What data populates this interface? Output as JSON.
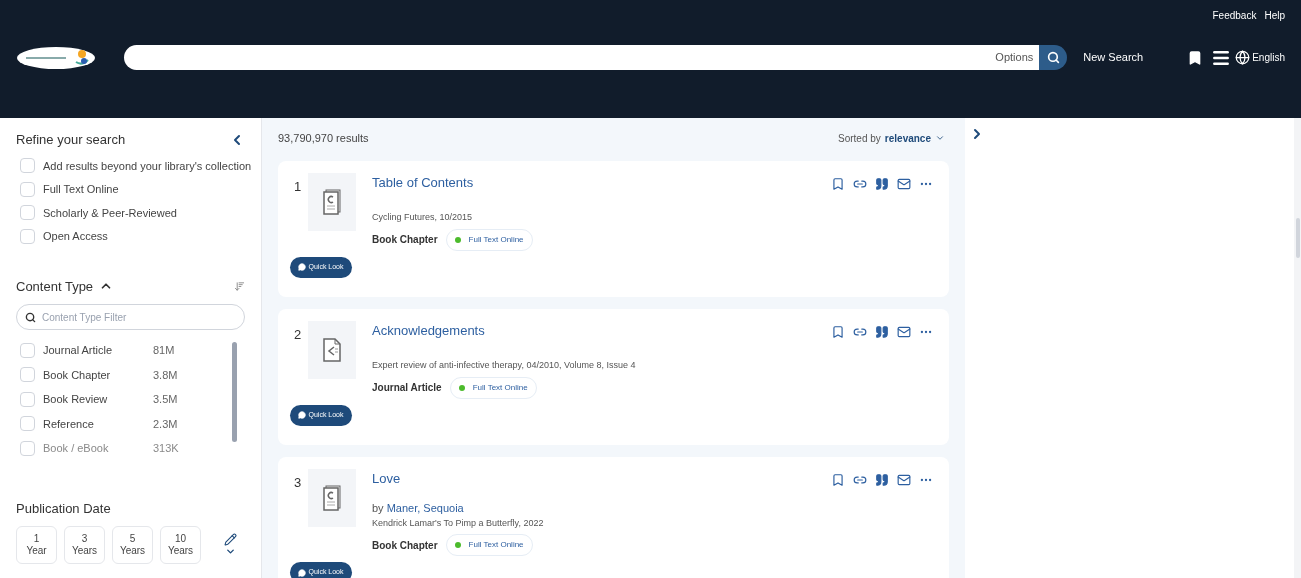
{
  "header": {
    "links": [
      "Feedback",
      "Help"
    ],
    "search": {
      "options_label": "Options"
    },
    "new_search": "New Search",
    "language": "English"
  },
  "sidebar": {
    "title": "Refine your search",
    "filters": [
      {
        "label": "Add results beyond your library's collection",
        "checked": false
      },
      {
        "label": "Full Text Online",
        "checked": false
      },
      {
        "label": "Scholarly & Peer-Reviewed",
        "checked": false
      },
      {
        "label": "Open Access",
        "checked": false
      }
    ],
    "content_type": {
      "title": "Content Type",
      "expanded": true,
      "filter_placeholder": "Content Type Filter",
      "items": [
        {
          "label": "Journal Article",
          "count": "81M",
          "checked": false,
          "faded": false
        },
        {
          "label": "Book Chapter",
          "count": "3.8M",
          "checked": false,
          "faded": false
        },
        {
          "label": "Book Review",
          "count": "3.5M",
          "checked": false,
          "faded": false
        },
        {
          "label": "Reference",
          "count": "2.3M",
          "checked": false,
          "faded": false
        },
        {
          "label": "Book / eBook",
          "count": "313K",
          "checked": false,
          "faded": true
        }
      ]
    },
    "publication_date": {
      "title": "Publication Date",
      "ranges": [
        {
          "number": "1",
          "unit": "Year"
        },
        {
          "number": "3",
          "unit": "Years"
        },
        {
          "number": "5",
          "unit": "Years"
        },
        {
          "number": "10",
          "unit": "Years"
        }
      ]
    }
  },
  "results": {
    "count": "93,790,970 results",
    "sort_prefix": "Sorted by",
    "sort_value": "relevance",
    "items": [
      {
        "number": "1",
        "title": "Table of Contents",
        "kind": "chapter",
        "source": "Cycling Futures, 10/2015",
        "type": "Book Chapter",
        "availability": "Full Text Online",
        "quick_look": "Quick Look"
      },
      {
        "number": "2",
        "title": "Acknowledgements",
        "kind": "article",
        "source": "Expert review of anti-infective therapy, 04/2010, Volume 8, Issue 4",
        "type": "Journal Article",
        "availability": "Full Text Online",
        "quick_look": "Quick Look"
      },
      {
        "number": "3",
        "title": "Love",
        "kind": "chapter",
        "authors": {
          "prefix": "by",
          "names": [
            "Maner, Sequoia"
          ]
        },
        "source": "Kendrick Lamar's To Pimp a Butterfly, 2022",
        "type": "Book Chapter",
        "availability": "Full Text Online",
        "quick_look": "Quick Look"
      }
    ]
  }
}
